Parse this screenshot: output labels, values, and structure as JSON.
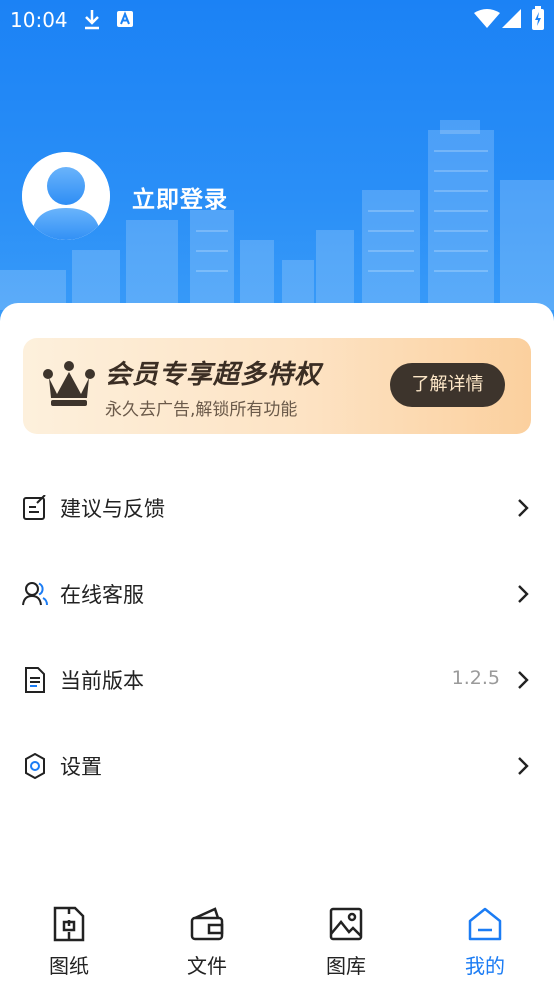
{
  "status_bar": {
    "time": "10:04"
  },
  "profile": {
    "login_label": "立即登录"
  },
  "vip": {
    "title": "会员专享超多特权",
    "subtitle": "永久去广告,解锁所有功能",
    "button_label": "了解详情"
  },
  "menu": {
    "items": [
      {
        "label": "建议与反馈",
        "icon": "feedback-edit-icon",
        "value": ""
      },
      {
        "label": "在线客服",
        "icon": "customer-service-icon",
        "value": ""
      },
      {
        "label": "当前版本",
        "icon": "document-icon",
        "value": "1.2.5"
      },
      {
        "label": "设置",
        "icon": "gear-icon",
        "value": ""
      }
    ]
  },
  "tabs": [
    {
      "label": "图纸",
      "icon": "drawing-icon",
      "active": false
    },
    {
      "label": "文件",
      "icon": "wallet-folder-icon",
      "active": false
    },
    {
      "label": "图库",
      "icon": "image-icon",
      "active": false
    },
    {
      "label": "我的",
      "icon": "home-icon",
      "active": true
    }
  ],
  "colors": {
    "header_blue": "#1b82f5",
    "accent_blue": "#1b7cf4",
    "vip_button": "#3d342c",
    "vip_gold": "#fde7c8"
  }
}
